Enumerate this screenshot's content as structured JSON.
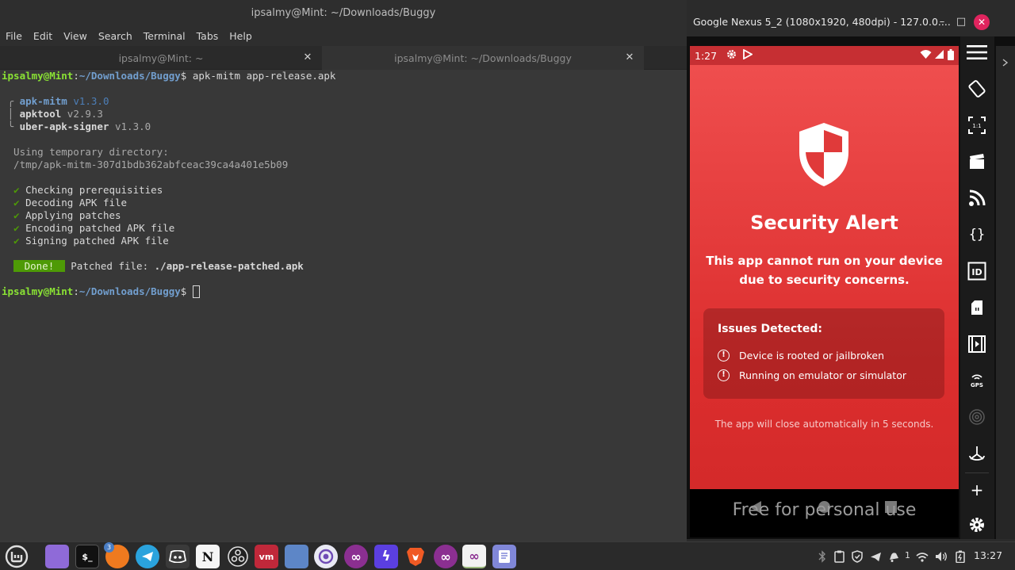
{
  "terminal": {
    "window_title": "ipsalmy@Mint: ~/Downloads/Buggy",
    "menu": [
      "File",
      "Edit",
      "View",
      "Search",
      "Terminal",
      "Tabs",
      "Help"
    ],
    "tabs": [
      {
        "label": "ipsalmy@Mint: ~"
      },
      {
        "label": "ipsalmy@Mint: ~/Downloads/Buggy"
      }
    ],
    "prompt": {
      "user": "ipsalmy@Mint",
      "path": "~/Downloads/Buggy",
      "symbol": "$"
    },
    "command": " apk-mitm app-release.apk",
    "tools": [
      {
        "prefix": " ╭ ",
        "name": "apk-mitm",
        "version": " v1.3.0"
      },
      {
        "prefix": " │ ",
        "name": "apktool",
        "version": " v2.9.3"
      },
      {
        "prefix": " ╰ ",
        "name": "uber-apk-signer",
        "version": " v1.3.0"
      }
    ],
    "temp_dir_label": "  Using temporary directory:",
    "temp_dir_path": "  /tmp/apk-mitm-307d1bdb362abfceac39ca4a401e5b09",
    "check_mark": "✔",
    "steps": [
      "Checking prerequisities",
      "Decoding APK file",
      "Applying patches",
      "Encoding patched APK file",
      "Signing patched APK file"
    ],
    "done_badge": " Done! ",
    "patched_label": " Patched file: ",
    "patched_file": "./app-release-patched.apk"
  },
  "emulator": {
    "title": "Google Nexus 5_2 (1080x1920, 480dpi) - 127.0.0....",
    "minimize": "–",
    "maximize": "□",
    "close": "✕",
    "status_time": "1:27",
    "alert": {
      "title": "Security Alert",
      "message": "This app cannot run on your device due to security concerns.",
      "issues_title": "Issues Detected:",
      "issue_icon": "!",
      "issues": [
        "Device is rooted or jailbroken",
        "Running on emulator or simulator"
      ],
      "countdown": "The app will close automatically in 5 seconds."
    },
    "watermark": "Free for personal use",
    "colors": {
      "alert_bg": "#e03a3a",
      "statusbar": "#c62f33"
    }
  },
  "taskbar": {
    "badge_count": "3",
    "tray_count": "1",
    "clock": "13:27",
    "apps": [
      {
        "name": "files",
        "glyph": ""
      },
      {
        "name": "terminal",
        "glyph": "$_"
      },
      {
        "name": "firefox",
        "glyph": ""
      },
      {
        "name": "telegram",
        "glyph": ""
      },
      {
        "name": "discord",
        "glyph": ""
      },
      {
        "name": "notion",
        "glyph": "N"
      },
      {
        "name": "obs",
        "glyph": ""
      },
      {
        "name": "vmware",
        "glyph": "vm"
      },
      {
        "name": "settings",
        "glyph": ""
      },
      {
        "name": "camera",
        "glyph": ""
      },
      {
        "name": "genymotion",
        "glyph": "∞"
      },
      {
        "name": "bolt",
        "glyph": "ϟ"
      },
      {
        "name": "brave",
        "glyph": ""
      },
      {
        "name": "genymotion-2",
        "glyph": "∞"
      },
      {
        "name": "genymotion-3",
        "glyph": "∞"
      },
      {
        "name": "text-editor",
        "glyph": ""
      }
    ]
  }
}
